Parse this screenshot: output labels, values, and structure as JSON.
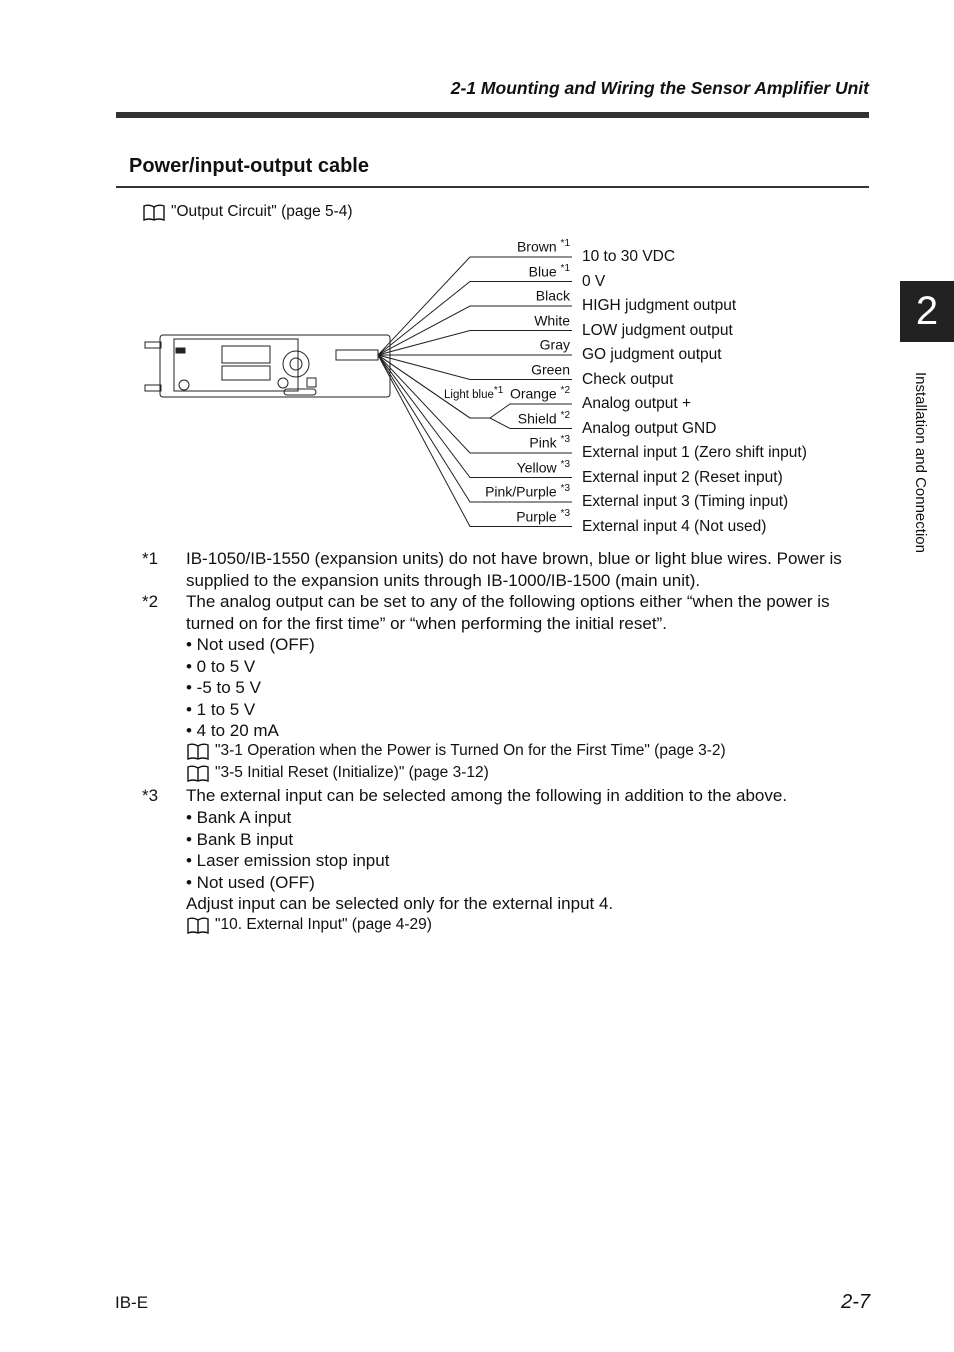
{
  "header": {
    "section": "2-1  Mounting and Wiring the Sensor Amplifier Unit"
  },
  "title": "Power/input-output cable",
  "ref_top": "\"Output Circuit\" (page 5-4)",
  "chapter": {
    "number": "2",
    "label": "Installation and Connection"
  },
  "diagram": {
    "light_blue": {
      "label": "Light blue",
      "note": "*1"
    },
    "wires": [
      {
        "color": "Brown",
        "note": "*1",
        "function": "10 to 30 VDC"
      },
      {
        "color": "Blue",
        "note": "*1",
        "function": "0 V"
      },
      {
        "color": "Black",
        "note": "",
        "function": "HIGH judgment output"
      },
      {
        "color": "White",
        "note": "",
        "function": "LOW judgment output"
      },
      {
        "color": "Gray",
        "note": "",
        "function": "GO judgment output"
      },
      {
        "color": "Green",
        "note": "",
        "function": "Check output"
      },
      {
        "color": "Orange",
        "note": "*2",
        "function": "Analog output +"
      },
      {
        "color": "Shield",
        "note": "*2",
        "function": "Analog output GND"
      },
      {
        "color": "Pink",
        "note": "*3",
        "function": "External input 1 (Zero shift input)"
      },
      {
        "color": "Yellow",
        "note": "*3",
        "function": "External input 2 (Reset input)"
      },
      {
        "color": "Pink/Purple",
        "note": "*3",
        "function": "External input 3 (Timing input)"
      },
      {
        "color": "Purple",
        "note": "*3",
        "function": "External input 4 (Not used)"
      }
    ]
  },
  "notes": {
    "n1": {
      "mark": "*1",
      "text": "IB-1050/IB-1550 (expansion units) do not have brown, blue or light blue wires. Power is supplied to the expansion units through IB-1000/IB-1500 (main unit)."
    },
    "n2": {
      "mark": "*2",
      "text": "The analog output can be set to any of the following options either “when the power is turned on for the first time” or “when performing the initial reset”.",
      "bullets": [
        "• Not used (OFF)",
        "• 0 to 5 V",
        "• -5 to 5 V",
        "• 1 to 5 V",
        "• 4 to 20 mA"
      ],
      "refs": [
        "\"3-1 Operation when the Power is Turned On for the First Time\" (page 3-2)",
        "\"3-5 Initial Reset (Initialize)\" (page 3-12)"
      ]
    },
    "n3": {
      "mark": "*3",
      "text": "The external input can be selected among the following in addition to the above.",
      "bullets": [
        "• Bank A input",
        "• Bank B input",
        "• Laser emission stop input",
        "• Not used (OFF)"
      ],
      "extra": "Adjust input can be selected only for the external input 4.",
      "ref": "\"10. External Input\" (page 4-29)"
    }
  },
  "footer": {
    "left": "IB-E",
    "right": "2-7"
  }
}
